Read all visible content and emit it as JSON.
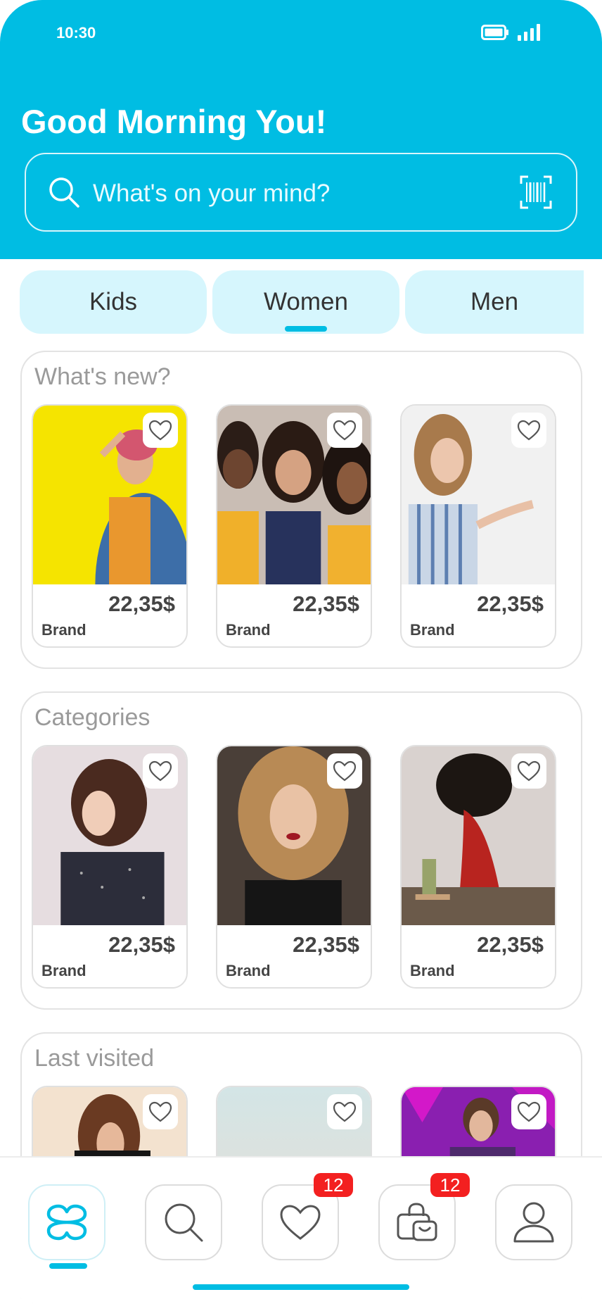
{
  "status": {
    "time": "10:30"
  },
  "header": {
    "greeting": "Good Morning You!",
    "search_placeholder": "What's on your mind?"
  },
  "tabs": [
    {
      "label": "Kids"
    },
    {
      "label": "Women",
      "selected": true
    },
    {
      "label": "Men"
    }
  ],
  "sections": {
    "whats_new": {
      "title": "What's new?",
      "items": [
        {
          "price": "22,35$",
          "brand": "Brand"
        },
        {
          "price": "22,35$",
          "brand": "Brand"
        },
        {
          "price": "22,35$",
          "brand": "Brand"
        }
      ]
    },
    "categories": {
      "title": "Categories",
      "items": [
        {
          "price": "22,35$",
          "brand": "Brand"
        },
        {
          "price": "22,35$",
          "brand": "Brand"
        },
        {
          "price": "22,35$",
          "brand": "Brand"
        }
      ]
    },
    "last_visited": {
      "title": "Last visited"
    }
  },
  "bottom_nav": {
    "wishlist_badge": "12",
    "bag_badge": "12"
  },
  "colors": {
    "accent": "#00bde3",
    "tab_bg": "#d6f6fd",
    "badge": "#f32020"
  }
}
